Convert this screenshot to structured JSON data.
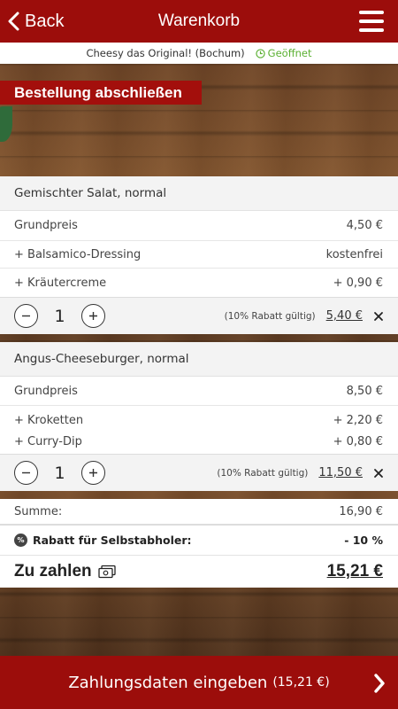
{
  "header": {
    "back_label": "Back",
    "title": "Warenkorb"
  },
  "shop": {
    "name": "Cheesy das Original! (Bochum)",
    "status": "Geöffnet"
  },
  "banner": "Bestellung abschließen",
  "items": [
    {
      "name": "Gemischter Salat, normal",
      "lines": [
        {
          "label": "Grundpreis",
          "value": "4,50 €"
        },
        {
          "label": "+ Balsamico-Dressing",
          "value": "kostenfrei"
        },
        {
          "label": "+ Kräutercreme",
          "value": "+ 0,90 €"
        }
      ],
      "quantity": "1",
      "discount_note": "(10% Rabatt gültig)",
      "total": "5,40 €"
    },
    {
      "name": "Angus-Cheeseburger, normal",
      "lines": [
        {
          "label": "Grundpreis",
          "value": "8,50 €"
        },
        {
          "label": "+ Kroketten",
          "value": "+ 2,20 €"
        },
        {
          "label": "+ Curry-Dip",
          "value": "+ 0,80 €"
        }
      ],
      "quantity": "1",
      "discount_note": "(10% Rabatt gültig)",
      "total": "11,50 €"
    }
  ],
  "summary": {
    "sum_label": "Summe:",
    "sum_value": "16,90 €",
    "discount_label": "Rabatt für Selbstabholer:",
    "discount_value": "- 10 %",
    "pay_label": "Zu zahlen",
    "pay_value": "15,21 €"
  },
  "cta": {
    "label": "Zahlungsdaten eingeben",
    "amount": "(15,21 €)"
  },
  "colors": {
    "brand_red": "#9c0d0b",
    "status_green": "#5bb032"
  },
  "icons": [
    "chevron-left-icon",
    "hamburger-menu-icon",
    "clock-icon",
    "minus-icon",
    "plus-icon",
    "close-icon",
    "percent-icon",
    "money-icon",
    "chevron-right-icon"
  ]
}
